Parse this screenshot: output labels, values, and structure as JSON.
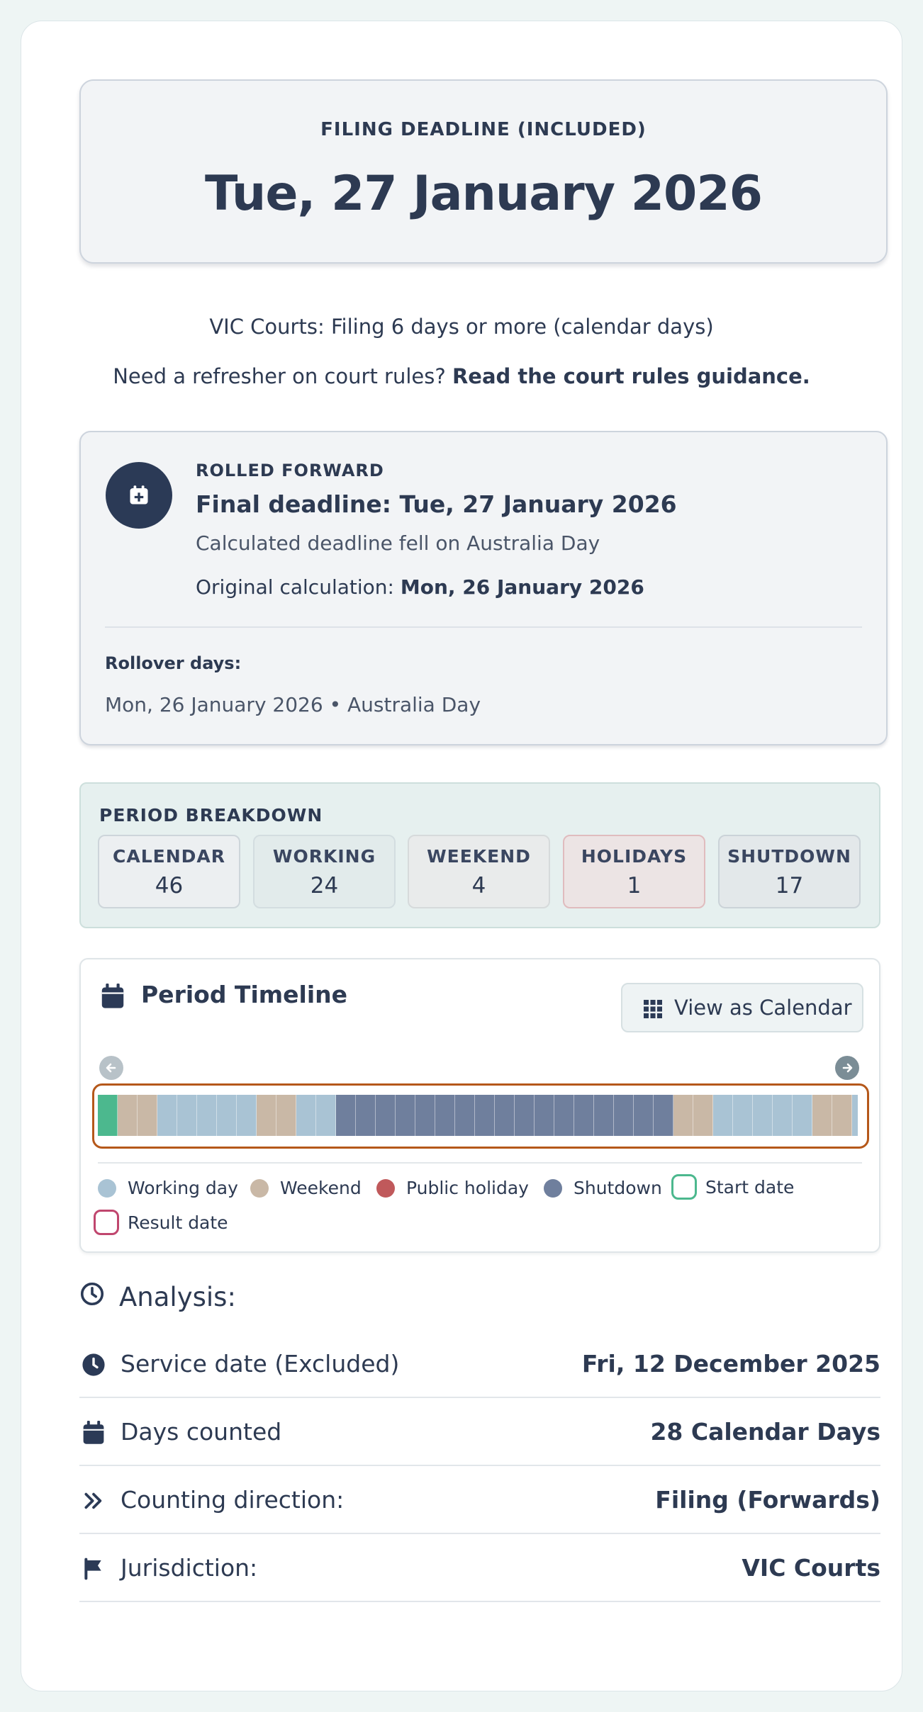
{
  "deadline": {
    "label": "FILING DEADLINE (INCLUDED)",
    "date": "Tue, 27 January 2026"
  },
  "rule_line": "VIC Courts: Filing 6 days or more (calendar days)",
  "refresher": {
    "text": "Need a refresher on court rules?",
    "link": "Read the court rules guidance."
  },
  "rolled": {
    "tag": "ROLLED FORWARD",
    "final": "Final deadline: Tue, 27 January 2026",
    "reason": "Calculated deadline fell on Australia Day",
    "original_label": "Original calculation:",
    "original_value": "Mon, 26 January 2026",
    "rollover_label": "Rollover days:",
    "rollover_item": "Mon, 26 January 2026 • Australia Day",
    "icon": "calendar-plus-icon"
  },
  "breakdown": {
    "title": "PERIOD BREAKDOWN",
    "stats": [
      {
        "label": "CALENDAR",
        "value": "46"
      },
      {
        "label": "WORKING",
        "value": "24"
      },
      {
        "label": "WEEKEND",
        "value": "4"
      },
      {
        "label": "HOLIDAYS",
        "value": "1"
      },
      {
        "label": "SHUTDOWN",
        "value": "17"
      }
    ]
  },
  "timeline": {
    "title": "Period Timeline",
    "view_button": "View as Calendar",
    "days": [
      "start",
      "weekend",
      "weekend",
      "working",
      "working",
      "working",
      "working",
      "working",
      "weekend",
      "weekend",
      "working",
      "working",
      "shutdown",
      "shutdown",
      "shutdown",
      "shutdown",
      "shutdown",
      "shutdown",
      "shutdown",
      "shutdown",
      "shutdown",
      "shutdown",
      "shutdown",
      "shutdown",
      "shutdown",
      "shutdown",
      "shutdown",
      "shutdown",
      "shutdown",
      "weekend",
      "weekend",
      "working",
      "working",
      "working",
      "working",
      "working",
      "weekend",
      "weekend",
      "working"
    ],
    "legend": [
      "Working day",
      "Weekend",
      "Public holiday",
      "Shutdown",
      "Start date",
      "Result date"
    ]
  },
  "colors": {
    "working": "#a9c3d4",
    "weekend": "#c9b8a6",
    "holiday": "#c0595b",
    "shutdown": "#6f7f9d",
    "start": "#4cb88e",
    "result": "#c0466e",
    "frame": "#b5581a"
  },
  "analysis": {
    "title": "Analysis:",
    "rows": [
      {
        "label": "Service date (Excluded)",
        "value": "Fri, 12 December 2025",
        "icon": "clock-icon"
      },
      {
        "label": "Days counted",
        "value": "28 Calendar Days",
        "icon": "calendar-icon"
      },
      {
        "label": "Counting direction:",
        "value": "Filing (Forwards)",
        "icon": "double-chevron-right-icon"
      },
      {
        "label": "Jurisdiction:",
        "value": "VIC Courts",
        "icon": "flag-icon"
      }
    ]
  }
}
